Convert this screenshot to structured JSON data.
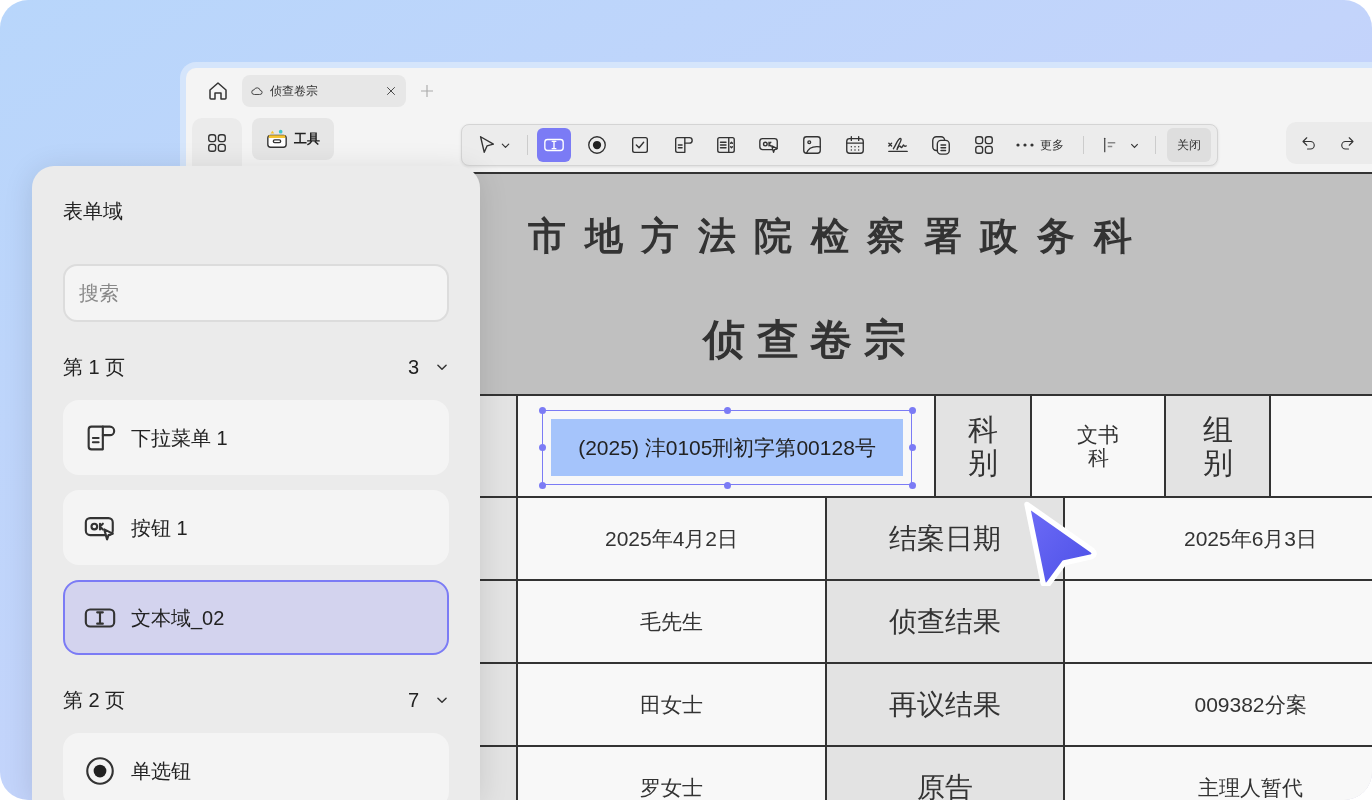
{
  "window": {
    "tabs": [
      {
        "label": "侦查卷宗",
        "selected": true
      }
    ],
    "tool_tab": "工具"
  },
  "toolbar": {
    "tools": [
      {
        "kind": "select",
        "selected": false
      },
      {
        "kind": "text_field",
        "selected": true
      },
      {
        "kind": "radio",
        "selected": false
      },
      {
        "kind": "checkbox",
        "selected": false
      },
      {
        "kind": "dropdown",
        "selected": false
      },
      {
        "kind": "listbox",
        "selected": false
      },
      {
        "kind": "button",
        "selected": false
      },
      {
        "kind": "image",
        "selected": false
      },
      {
        "kind": "date",
        "selected": false
      },
      {
        "kind": "signature",
        "selected": false
      },
      {
        "kind": "copy",
        "selected": false
      },
      {
        "kind": "grid",
        "selected": false
      }
    ],
    "more": "更多",
    "close": "关闭"
  },
  "panel": {
    "title": "表单域",
    "search": {
      "placeholder": "搜索"
    },
    "pages": [
      {
        "label": "第 1 页",
        "count": "3",
        "expanded": true,
        "items": [
          {
            "kind": "dropdown",
            "label": "下拉菜单 1",
            "selected": false
          },
          {
            "kind": "button",
            "label": "按钮 1",
            "selected": false
          },
          {
            "kind": "text_field",
            "label": "文本域_02",
            "selected": true
          }
        ]
      },
      {
        "label": "第 2 页",
        "count": "7",
        "expanded": true,
        "items": [
          {
            "kind": "radio",
            "label": "单选钮",
            "selected": false
          }
        ]
      }
    ]
  },
  "document": {
    "title": "市 地 方 法 院 检 察 署 政 务 科",
    "subtitle": "侦 查 卷 宗",
    "field": {
      "value": "(2025) 沣0105刑初字第00128号",
      "selected": true
    },
    "header_cells": [
      {
        "kind": "label",
        "text": "科别"
      },
      {
        "kind": "value",
        "text": "文书科"
      },
      {
        "kind": "label",
        "text": "组别"
      }
    ],
    "rows": [
      {
        "value": "2025年4月2日",
        "label": "结案日期",
        "result": "2025年6月3日"
      },
      {
        "value": "毛先生",
        "label": "侦查结果"
      },
      {
        "value": "田女士",
        "label": "再议结果",
        "result": "009382分案"
      },
      {
        "value": "罗女士",
        "label": "原告",
        "result": "主理人暂代"
      }
    ]
  }
}
